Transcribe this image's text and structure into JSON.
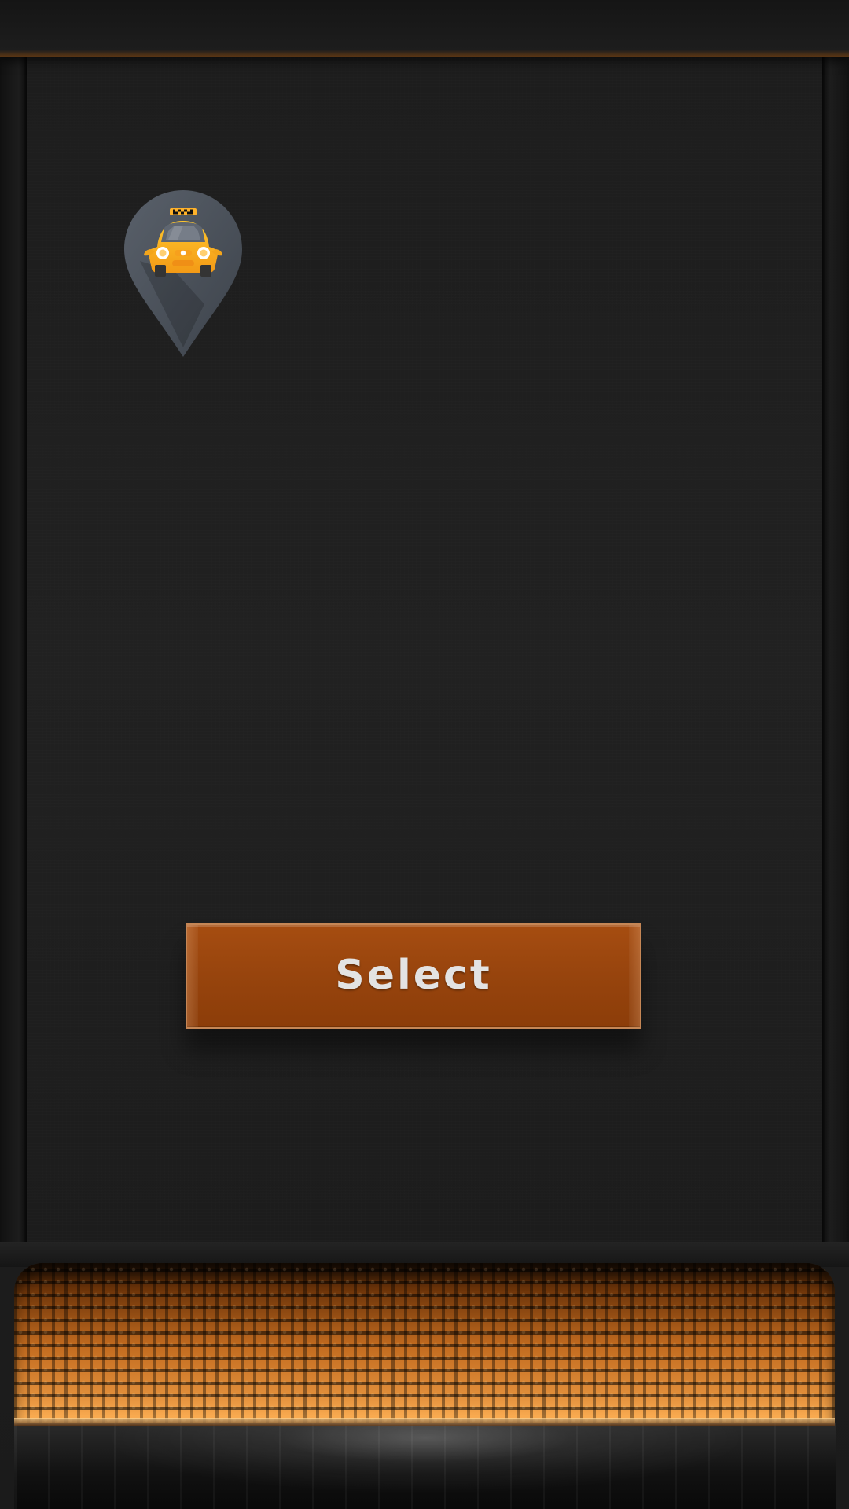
{
  "screen": {
    "select_button_label": "Select"
  },
  "icons": {
    "map_pin": "taxi-location-pin-icon"
  },
  "colors": {
    "button": "#97440d",
    "button_border": "#c58655",
    "taxi_yellow": "#f3a51b",
    "pin_gray": "#4a4f57",
    "grill_orange": "#c26b1f"
  }
}
